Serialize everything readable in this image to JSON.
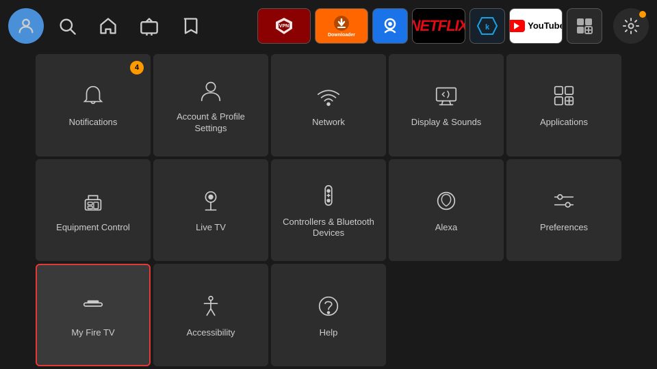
{
  "nav": {
    "avatar_label": "User Avatar",
    "search_label": "Search",
    "home_label": "Home",
    "tv_label": "Live TV",
    "bookmark_label": "Bookmarks",
    "settings_dot_label": "Notification dot"
  },
  "apps": [
    {
      "id": "expressvpn",
      "label": "ExpressVPN"
    },
    {
      "id": "downloader",
      "label": "Downloader"
    },
    {
      "id": "blue-app",
      "label": "Blue App"
    },
    {
      "id": "netflix",
      "label": "Netflix"
    },
    {
      "id": "kodi",
      "label": "Kodi"
    },
    {
      "id": "youtube",
      "label": "YouTube"
    },
    {
      "id": "grid",
      "label": "Grid"
    }
  ],
  "tiles": [
    {
      "id": "notifications",
      "label": "Notifications",
      "badge": "4",
      "selected": false
    },
    {
      "id": "account-profile",
      "label": "Account & Profile Settings",
      "badge": null,
      "selected": false
    },
    {
      "id": "network",
      "label": "Network",
      "badge": null,
      "selected": false
    },
    {
      "id": "display-sounds",
      "label": "Display & Sounds",
      "badge": null,
      "selected": false
    },
    {
      "id": "applications",
      "label": "Applications",
      "badge": null,
      "selected": false
    },
    {
      "id": "equipment-control",
      "label": "Equipment Control",
      "badge": null,
      "selected": false
    },
    {
      "id": "live-tv",
      "label": "Live TV",
      "badge": null,
      "selected": false
    },
    {
      "id": "controllers-bluetooth",
      "label": "Controllers & Bluetooth Devices",
      "badge": null,
      "selected": false
    },
    {
      "id": "alexa",
      "label": "Alexa",
      "badge": null,
      "selected": false
    },
    {
      "id": "preferences",
      "label": "Preferences",
      "badge": null,
      "selected": false
    },
    {
      "id": "my-fire-tv",
      "label": "My Fire TV",
      "badge": null,
      "selected": true
    },
    {
      "id": "accessibility",
      "label": "Accessibility",
      "badge": null,
      "selected": false
    },
    {
      "id": "help",
      "label": "Help",
      "badge": null,
      "selected": false
    }
  ]
}
